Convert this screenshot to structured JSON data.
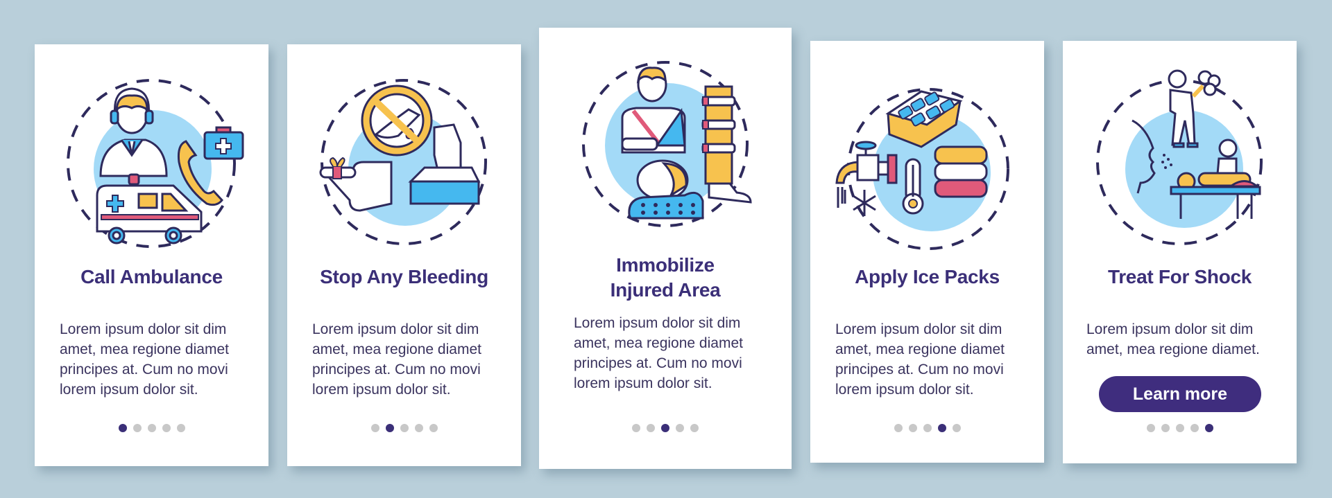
{
  "colors": {
    "background": "#b9cfda",
    "heading": "#3b2f78",
    "body_text": "#3a335e",
    "dot_active": "#3b2f78",
    "dot_inactive": "#c8c8c8",
    "button": "#3f2d7e",
    "outline": "#2e2a5c",
    "yellow": "#f7c24e",
    "light_blue": "#a3daf7",
    "bright_blue": "#45b8ef",
    "pink": "#e05a7a"
  },
  "cards": [
    {
      "title_lines": [
        "Call Ambulance"
      ],
      "illustration": "call-ambulance-illustration",
      "body_lines": [
        "Lorem ipsum dolor sit dim",
        "amet, mea regione diamet",
        "principes at. Cum no movi",
        "lorem ipsum dolor sit."
      ],
      "active_dot": 0
    },
    {
      "title_lines": [
        "Stop Any Bleeding"
      ],
      "illustration": "stop-bleeding-illustration",
      "body_lines": [
        "Lorem ipsum dolor sit dim",
        "amet, mea regione diamet",
        "principes at. Cum no movi",
        "lorem ipsum dolor sit."
      ],
      "active_dot": 1
    },
    {
      "title_lines": [
        "Immobilize",
        "Injured Area"
      ],
      "illustration": "immobilize-illustration",
      "body_lines": [
        "Lorem ipsum dolor sit dim",
        "amet, mea regione diamet",
        "principes at. Cum no movi",
        "lorem ipsum dolor sit."
      ],
      "active_dot": 2
    },
    {
      "title_lines": [
        "Apply Ice Packs"
      ],
      "illustration": "ice-packs-illustration",
      "body_lines": [
        "Lorem ipsum dolor sit dim",
        "amet, mea regione diamet",
        "principes at. Cum no movi",
        "lorem ipsum dolor sit."
      ],
      "active_dot": 3
    },
    {
      "title_lines": [
        "Treat For Shock"
      ],
      "illustration": "treat-shock-illustration",
      "body_lines": [
        "Lorem ipsum dolor sit dim",
        "amet, mea regione diamet."
      ],
      "button_label": "Learn more",
      "active_dot": 4
    }
  ],
  "pagination": {
    "total": 5
  }
}
